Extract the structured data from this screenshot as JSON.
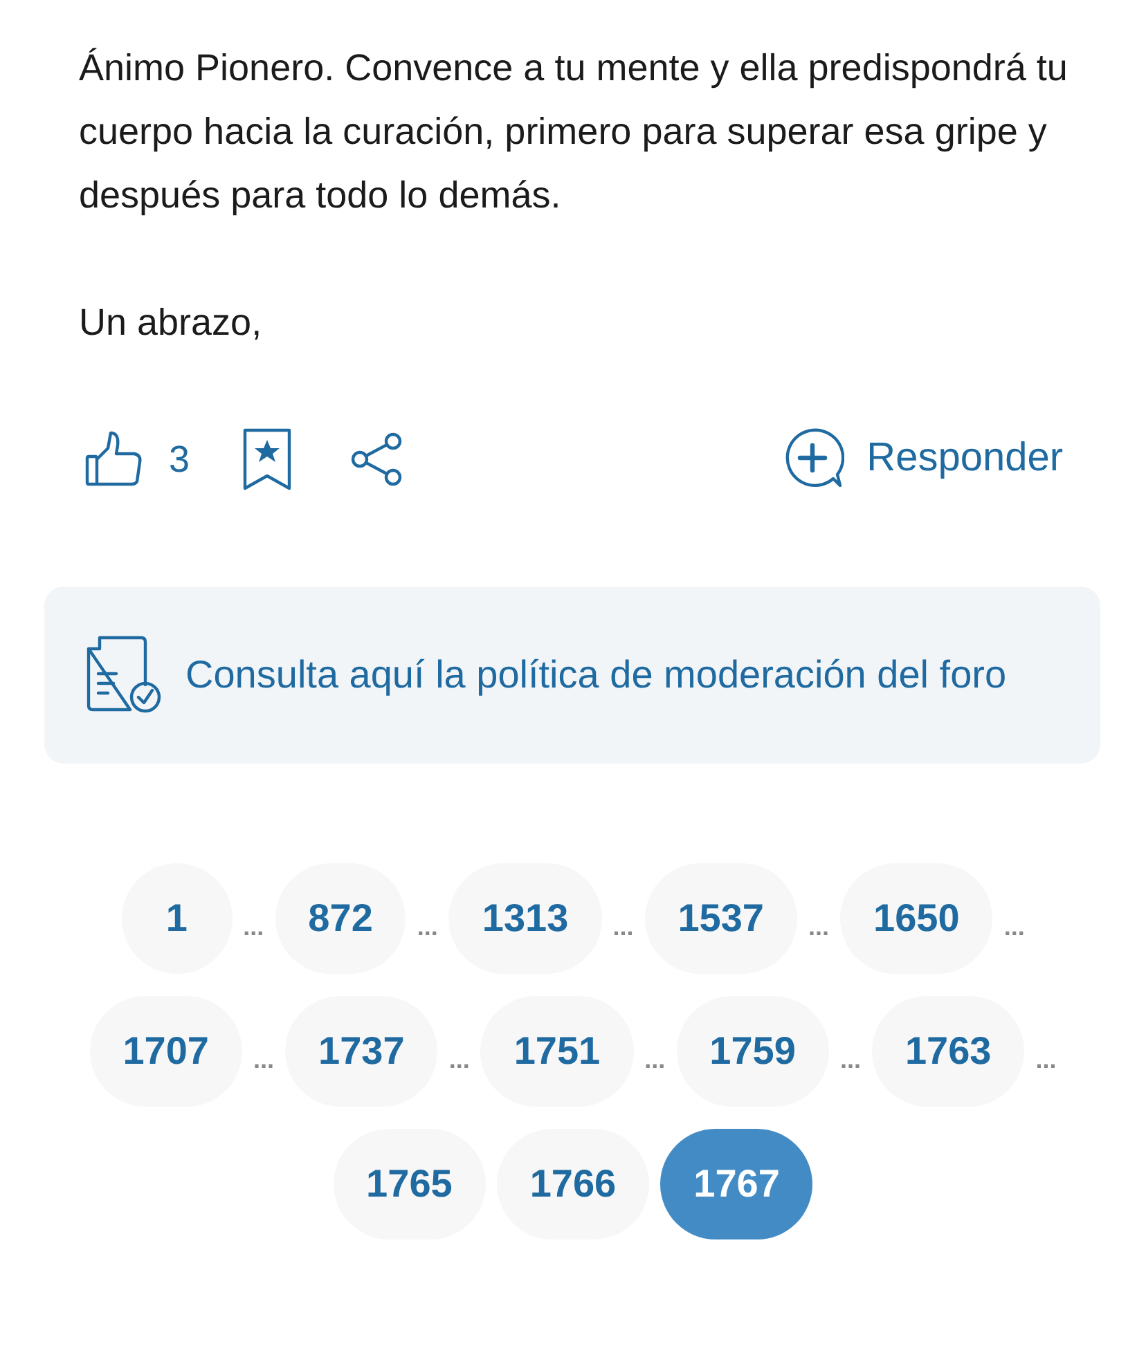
{
  "post": {
    "paragraphs": [
      "Ánimo Pionero. Convence a tu mente y ella predispondrá tu cuerpo hacia la curación, primero para superar esa gripe y después para todo lo demás.",
      "Un abrazo,"
    ]
  },
  "actions": {
    "likes": "3",
    "reply": "Responder"
  },
  "notice": {
    "text": "Consulta aquí la política de moderación del foro"
  },
  "pagination": [
    {
      "kind": "page",
      "label": "1",
      "selected": false
    },
    {
      "kind": "ellipsis",
      "label": "..."
    },
    {
      "kind": "page",
      "label": "872",
      "selected": false
    },
    {
      "kind": "ellipsis",
      "label": "..."
    },
    {
      "kind": "page",
      "label": "1313",
      "selected": false
    },
    {
      "kind": "ellipsis",
      "label": "..."
    },
    {
      "kind": "page",
      "label": "1537",
      "selected": false
    },
    {
      "kind": "ellipsis",
      "label": "..."
    },
    {
      "kind": "page",
      "label": "1650",
      "selected": false
    },
    {
      "kind": "ellipsis",
      "label": "..."
    },
    {
      "kind": "page",
      "label": "1707",
      "selected": false
    },
    {
      "kind": "ellipsis",
      "label": "..."
    },
    {
      "kind": "page",
      "label": "1737",
      "selected": false
    },
    {
      "kind": "ellipsis",
      "label": "..."
    },
    {
      "kind": "page",
      "label": "1751",
      "selected": false
    },
    {
      "kind": "ellipsis",
      "label": "..."
    },
    {
      "kind": "page",
      "label": "1759",
      "selected": false
    },
    {
      "kind": "ellipsis",
      "label": "..."
    },
    {
      "kind": "page",
      "label": "1763",
      "selected": false
    },
    {
      "kind": "ellipsis",
      "label": "..."
    },
    {
      "kind": "page",
      "label": "1765",
      "selected": false
    },
    {
      "kind": "page",
      "label": "1766",
      "selected": false
    },
    {
      "kind": "page",
      "label": "1767",
      "selected": true
    }
  ]
}
